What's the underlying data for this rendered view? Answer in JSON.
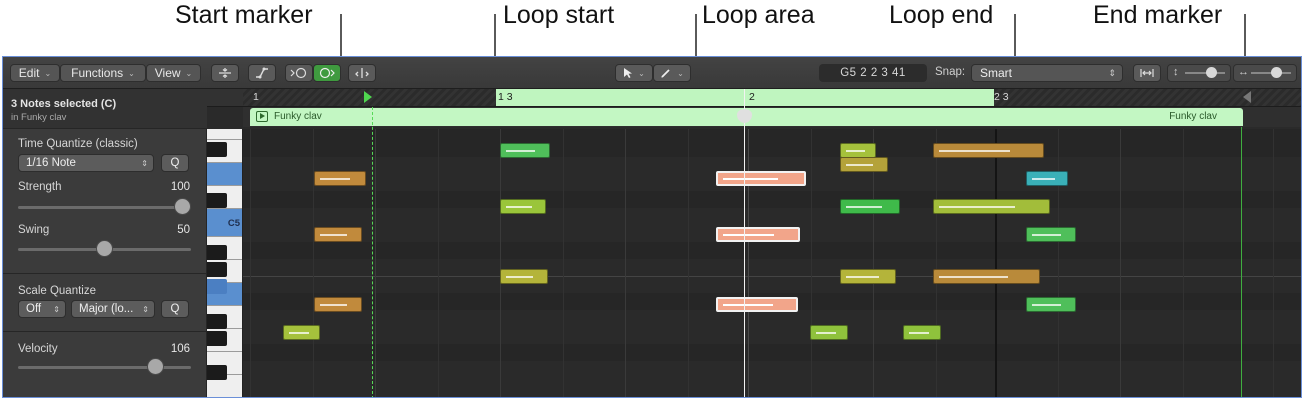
{
  "callouts": {
    "start_marker": "Start marker",
    "loop_start": "Loop start",
    "loop_area": "Loop area",
    "loop_end": "Loop end",
    "end_marker": "End marker"
  },
  "toolbar": {
    "edit": "Edit",
    "functions": "Functions",
    "view": "View",
    "position_display": "G5   2 2 3 41",
    "snap_label": "Snap:",
    "snap_value": "Smart"
  },
  "inspector": {
    "selection_title": "3 Notes selected (C)",
    "selection_subtitle": "in Funky clav",
    "time_quantize_title": "Time Quantize (classic)",
    "time_quantize_value": "1/16 Note",
    "q_label": "Q",
    "strength_label": "Strength",
    "strength_value": "100",
    "strength_level": 1.0,
    "swing_label": "Swing",
    "swing_value": "50",
    "swing_level": 0.5,
    "scale_quantize_title": "Scale Quantize",
    "scale_off": "Off",
    "scale_type": "Major (lo...",
    "velocity_label": "Velocity",
    "velocity_value": "106",
    "velocity_level": 0.83
  },
  "piano": {
    "c5_label": "C5"
  },
  "ruler": {
    "bar_1": "1",
    "loop_start": "1 3",
    "bar_2": "2",
    "loop_end": "2 3"
  },
  "region": {
    "name": "Funky clav"
  },
  "colors": {
    "loop_green": "#bff5bf",
    "selected_note": "#f2a58a",
    "accent_blue": "#5a8fcf"
  }
}
